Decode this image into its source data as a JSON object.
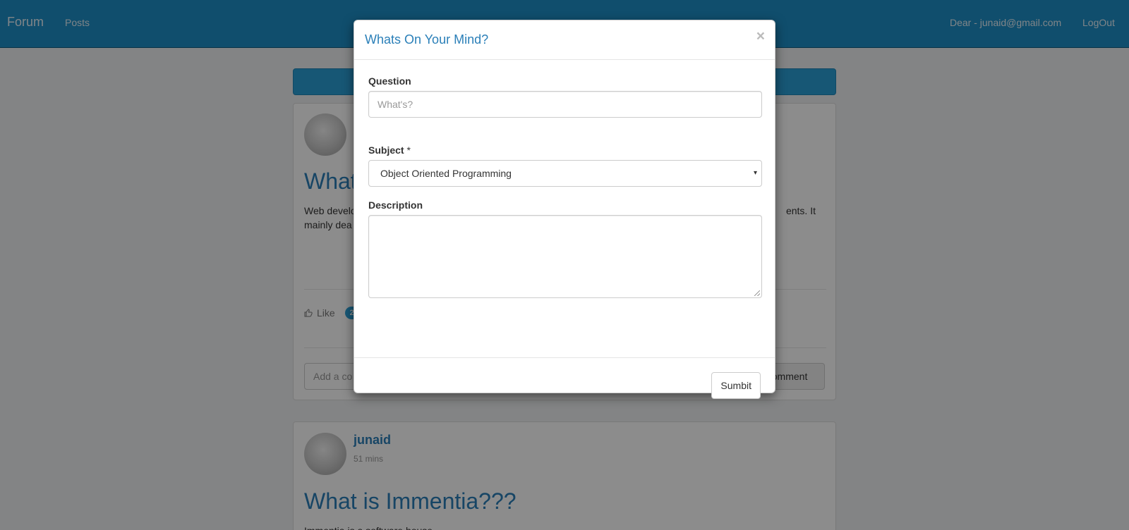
{
  "navbar": {
    "brand": "Forum",
    "posts_link": "Posts",
    "user_label": "Dear - junaid@gmail.com",
    "logout_link": "LogOut"
  },
  "feed": {
    "post1": {
      "title": "What",
      "body_start_line1": "Web develo",
      "body_end_line1": "ents. It",
      "body_start_line2": "mainly dea",
      "like_label": "Like",
      "like_count": "2",
      "comment_placeholder": "Add a co",
      "comment_button": "Comment"
    },
    "post2": {
      "author": "junaid",
      "time": "51 mins",
      "title": "What is Immentia???",
      "body": "Immentia is a software house."
    }
  },
  "modal": {
    "title": "Whats On Your Mind?",
    "close_glyph": "×",
    "question_label": "Question",
    "question_placeholder": "What's?",
    "subject_label": "Subject",
    "subject_required": "*",
    "subject_value": "Object Oriented Programming",
    "subject_caret": "▾",
    "description_label": "Description",
    "submit_label": "Sumbit"
  }
}
